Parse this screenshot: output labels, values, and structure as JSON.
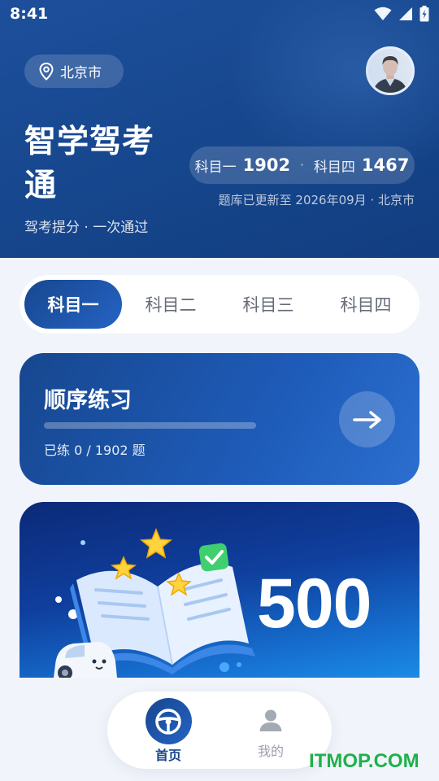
{
  "status_bar": {
    "time": "8:41",
    "icons": [
      "wifi-icon",
      "signal-icon",
      "battery-icon"
    ]
  },
  "header": {
    "location": "北京市",
    "location_icon": "location-pin-icon",
    "title": "智学驾考通",
    "subtitle": "驾考提分 · 一次通过",
    "counts": {
      "subject1_label": "科目一",
      "subject1_count": "1902",
      "separator": "·",
      "subject4_label": "科目四",
      "subject4_count": "1467"
    },
    "update_note": "题库已更新至 2026年09月 · 北京市"
  },
  "tabs": [
    {
      "label": "科目一",
      "active": true
    },
    {
      "label": "科目二",
      "active": false
    },
    {
      "label": "科目三",
      "active": false
    },
    {
      "label": "科目四",
      "active": false
    }
  ],
  "practice": {
    "title": "顺序练习",
    "progress_text": "已练 0 / 1902 题",
    "progress_fraction": 0,
    "arrow_icon": "arrow-right-icon"
  },
  "banner": {
    "number": "500"
  },
  "bottom_nav": [
    {
      "label": "首页",
      "icon": "steering-wheel-icon",
      "active": true
    },
    {
      "label": "我的",
      "icon": "person-icon",
      "active": false
    }
  ],
  "watermark": "ITMOP.COM",
  "colors": {
    "primary": "#17478f",
    "accent": "#2563c4",
    "background": "#f1f4fa",
    "watermark": "#1fb14b"
  }
}
